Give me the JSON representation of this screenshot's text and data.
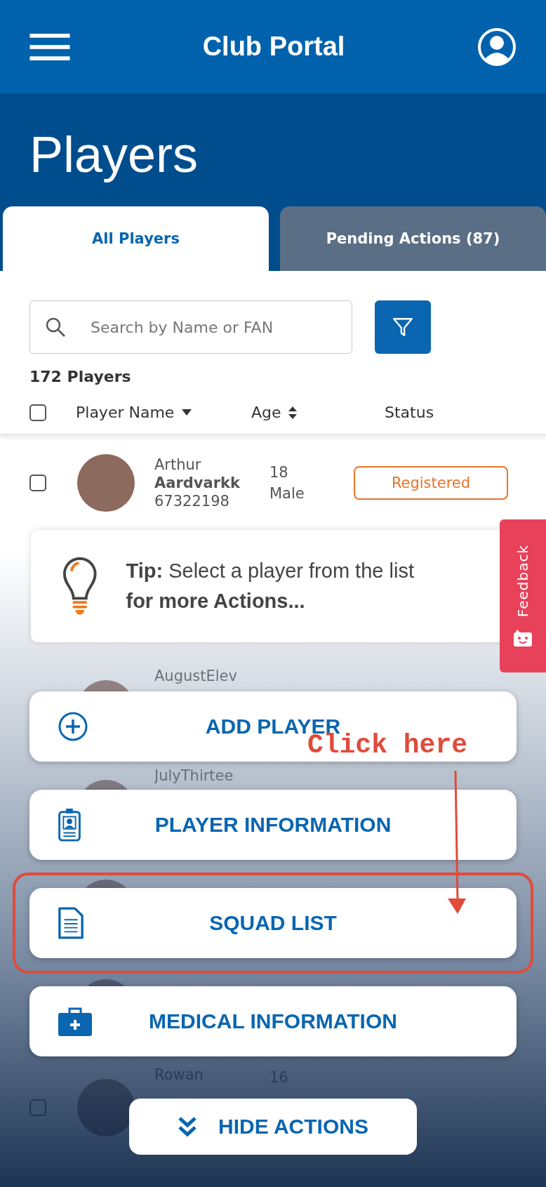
{
  "header": {
    "title": "Club Portal"
  },
  "page_title": "Players",
  "tabs": [
    {
      "label": "All Players",
      "selected": true
    },
    {
      "label": "Pending Actions (87)",
      "selected": false
    }
  ],
  "search": {
    "placeholder": "Search by Name or FAN"
  },
  "player_count": "172 Players",
  "table": {
    "select_all_checked": false,
    "columns": [
      {
        "label": "Player Name"
      },
      {
        "label": "Age"
      },
      {
        "label": "Status"
      }
    ],
    "rows": [
      {
        "first_name": "Arthur",
        "last_name": "Aardvarkk",
        "fan": "67322198",
        "age": "18",
        "gender": "Male",
        "status": {
          "label": "Registered",
          "color": "#e8742a"
        },
        "checked": false
      },
      {
        "first_name": "AugustElev",
        "photo": true
      },
      {
        "first_name": "JulyThirtee",
        "photo": true
      },
      {
        "photo": true
      },
      {
        "photo": true
      },
      {
        "first_name": "Rowan",
        "age": "16",
        "checked": false
      }
    ]
  },
  "tip": {
    "text": "**Tip:** Select a player from the list **for more Actions...**"
  },
  "feedback": {
    "label": "Feedback"
  },
  "actions": [
    {
      "label": "ADD PLAYER",
      "kind": "plus",
      "highlighted": false
    },
    {
      "label": "PLAYER INFORMATION",
      "kind": "badge",
      "highlighted": false
    },
    {
      "label": "SQUAD LIST",
      "kind": "document",
      "highlighted": true
    },
    {
      "label": "MEDICAL INFORMATION",
      "kind": "medical",
      "highlighted": false
    }
  ],
  "hide_actions": {
    "label": "HIDE ACTIONS"
  },
  "annotation": {
    "label": "Click here"
  }
}
